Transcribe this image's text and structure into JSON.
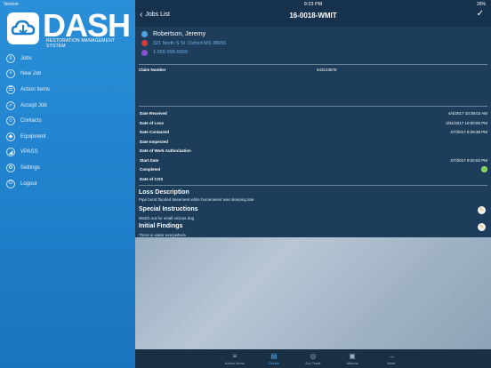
{
  "status": {
    "carrier": "Verizon",
    "time": "9:23 PM",
    "battery": "26%"
  },
  "logo": {
    "text": "DASH",
    "subtitle": "RESTORATION MANAGEMENT SYSTEM"
  },
  "nav": [
    {
      "label": "Jobs",
      "icon": "jobs-icon",
      "glyph": "≡"
    },
    {
      "label": "New Job",
      "icon": "new-job-icon",
      "glyph": "+"
    },
    {
      "label": "Action Items",
      "icon": "action-items-icon",
      "glyph": "☰"
    },
    {
      "label": "Accept Job",
      "icon": "accept-job-icon",
      "glyph": "✓"
    },
    {
      "label": "Contacts",
      "icon": "contacts-icon",
      "glyph": "☺"
    },
    {
      "label": "Equipment",
      "icon": "equipment-icon",
      "glyph": "◆"
    },
    {
      "label": "VPASS",
      "icon": "vpass-icon",
      "glyph": "◢"
    },
    {
      "label": "Settings",
      "icon": "settings-icon",
      "glyph": "⚙"
    },
    {
      "label": "Logout",
      "icon": "logout-icon",
      "glyph": "⏻"
    }
  ],
  "header": {
    "back_label": "Jobs List",
    "title": "16-0018-WMIT"
  },
  "customer": {
    "name": "Robertson, Jeremy",
    "address": "321 North S St. Oxford MS 38655",
    "phone": "1-555-555-5555"
  },
  "claim": {
    "label": "Claim Number",
    "value": "543123678"
  },
  "dates": [
    {
      "label": "Date Received",
      "value": "4/4/2017 10:39:02 AM"
    },
    {
      "label": "Date of Loss",
      "value": "3/31/2017 10:00:00 PM"
    },
    {
      "label": "Date Contacted",
      "value": "4/7/2017 8:29:38 PM"
    },
    {
      "label": "Date Inspected",
      "value": ""
    },
    {
      "label": "Date of Work Authorization",
      "value": ""
    },
    {
      "label": "Start Date",
      "value": "4/7/2017 9:20:02 PM"
    },
    {
      "label": "Completed",
      "value": ""
    },
    {
      "label": "Date of COS",
      "value": ""
    }
  ],
  "sections": {
    "loss_title": "Loss Description",
    "loss_body": "Pipe burst flooded basement while homeowner was sleeping late",
    "special_title": "Special Instructions",
    "special_body": "Watch out for small vicious dog",
    "findings_title": "Initial Findings",
    "findings_body": "There is water everywhere"
  },
  "tabs": [
    {
      "label": "Action Items",
      "glyph": "≡"
    },
    {
      "label": "Details",
      "glyph": "▤"
    },
    {
      "label": "Dry Track",
      "glyph": "◎"
    },
    {
      "label": "Albums",
      "glyph": "▣"
    },
    {
      "label": "More",
      "glyph": "→"
    }
  ],
  "colors": {
    "sidebar": "#2a8fd8",
    "accent": "#4ea4e6",
    "address": "#d63b3b",
    "phone": "#8a4fd6",
    "completed": "#7ed04a",
    "edit": "#e59b18"
  }
}
